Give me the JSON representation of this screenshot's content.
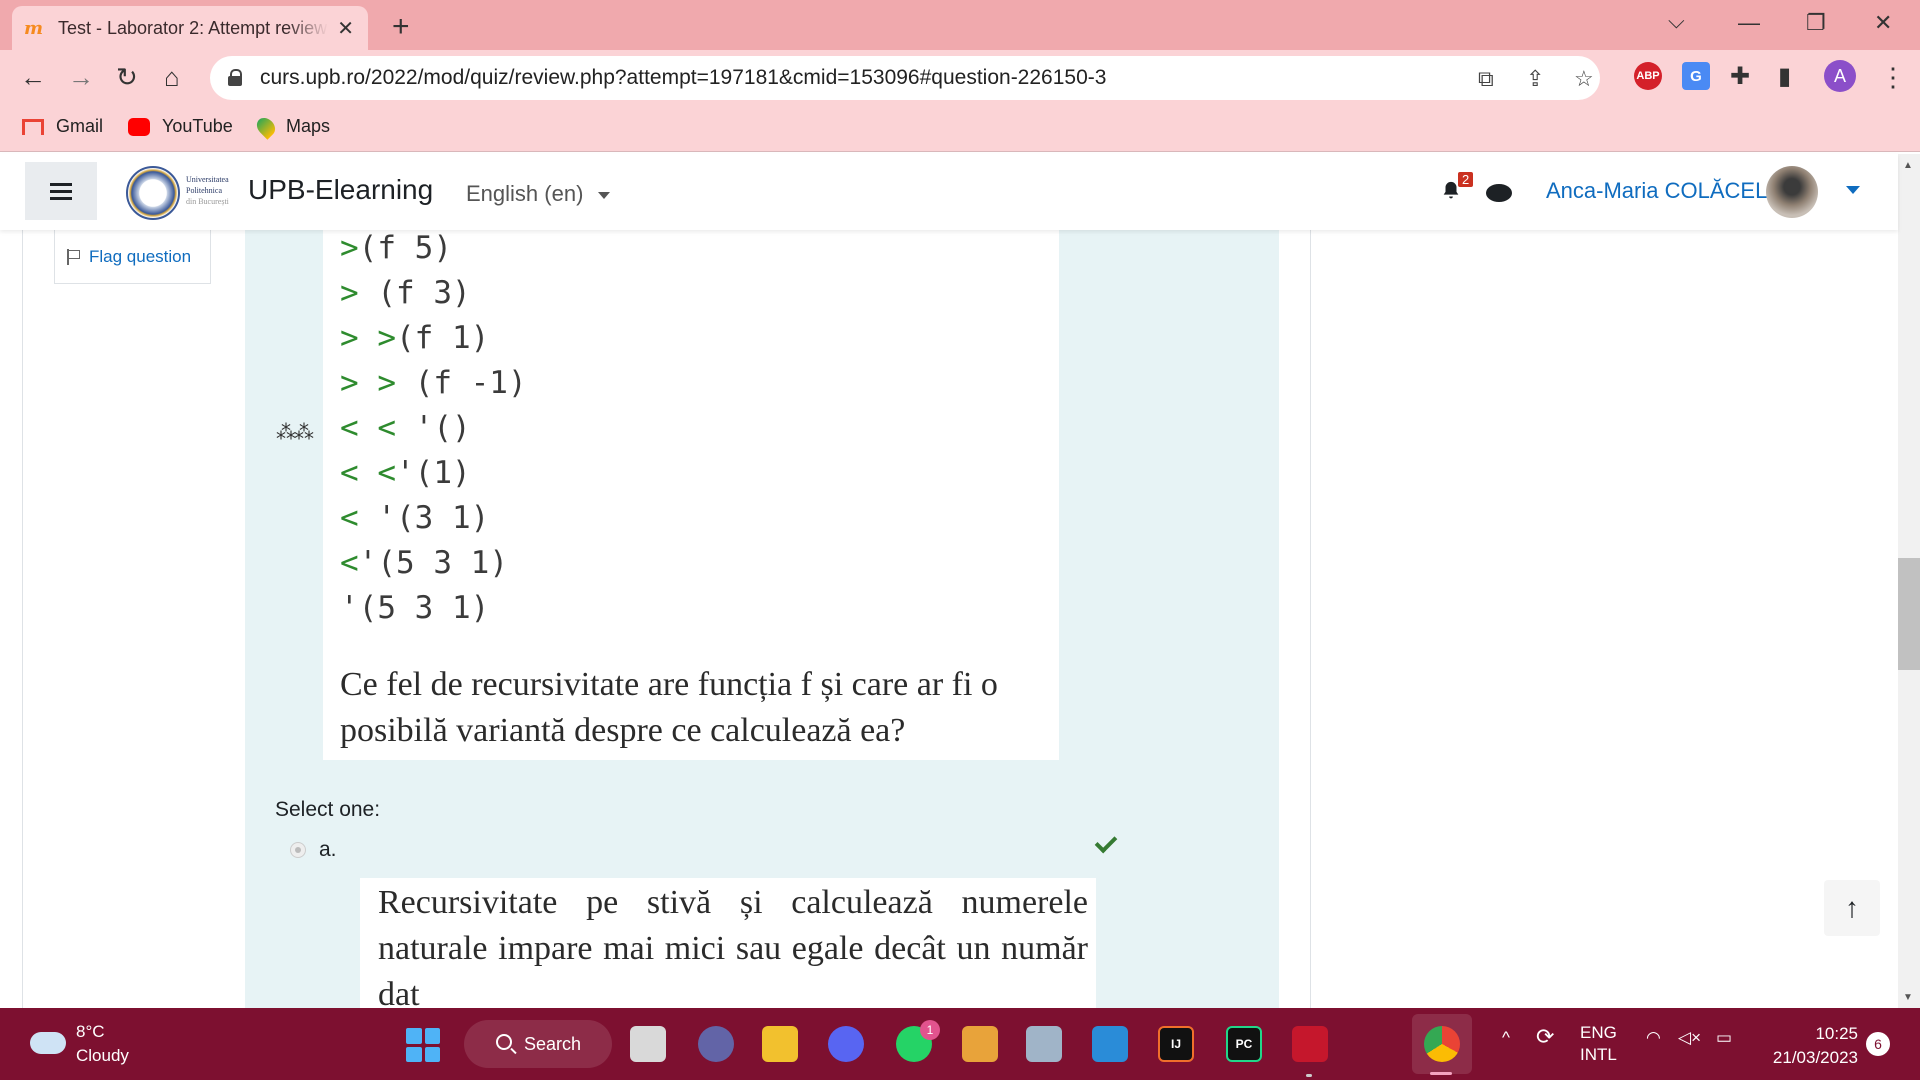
{
  "browser": {
    "tab_title": "Test - Laborator 2: Attempt review",
    "url": "curs.upb.ro/2022/mod/quiz/review.php?attempt=197181&cmid=153096#question-226150-3",
    "avatar_letter": "A",
    "bookmarks": [
      {
        "label": "Gmail",
        "icon": "gmail-icon"
      },
      {
        "label": "YouTube",
        "icon": "youtube-icon"
      },
      {
        "label": "Maps",
        "icon": "maps-icon"
      }
    ],
    "extensions": [
      "abp-icon",
      "translate-icon",
      "puzzle-icon",
      "sidepanel-icon"
    ]
  },
  "header": {
    "logo_text": [
      "Universitatea",
      "Politehnica",
      "din București"
    ],
    "site_name": "UPB-Elearning",
    "language": "English (en)",
    "notification_count": "2",
    "user_name": "Anca-Maria COLĂCEL"
  },
  "question": {
    "flag_label": "Flag question",
    "code_lines": [
      {
        "prefix": ">",
        "rest": "(f 5)"
      },
      {
        "prefix": "> ",
        "rest": "(f 3)"
      },
      {
        "prefix": "> >",
        "rest": "(f 1)"
      },
      {
        "prefix": "> > ",
        "rest": "(f -1)"
      },
      {
        "prefix": "< < ",
        "rest": "'()"
      },
      {
        "prefix": "< <",
        "rest": "'(1)"
      },
      {
        "prefix": "< ",
        "rest": "'(3 1)"
      },
      {
        "prefix": "<",
        "rest": "'(5 3 1)"
      },
      {
        "prefix": "",
        "rest": "'(5 3 1)"
      }
    ],
    "text": "Ce fel de recursivitate are funcția f și care ar fi o posibilă variantă despre ce calculează ea?",
    "select_label": "Select one:",
    "option_letter": "a.",
    "option_text": "Recursivitate pe stivă și calculează numerele naturale impare mai mici sau egale decât un număr dat"
  },
  "taskbar": {
    "temperature": "8°C",
    "weather": "Cloudy",
    "search_label": "Search",
    "whatsapp_badge": "1",
    "language_top": "ENG",
    "language_bottom": "INTL",
    "time": "10:25",
    "date": "21/03/2023",
    "notifications": "6"
  }
}
